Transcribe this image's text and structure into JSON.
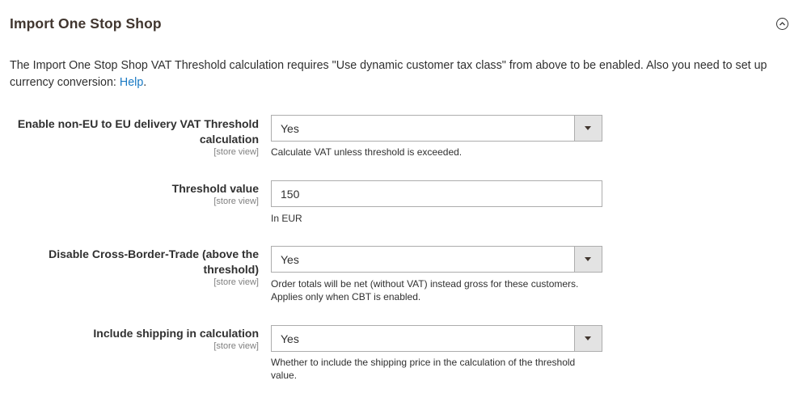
{
  "section": {
    "title": "Import One Stop Shop",
    "collapse_icon": "chevron-up-circle-icon",
    "intro_text": "The Import One Stop Shop VAT Threshold calculation requires \"Use dynamic customer tax class\" from above to be enabled. Also you need to set up currency conversion: ",
    "intro_link": "Help",
    "intro_end": "."
  },
  "fields": [
    {
      "label": "Enable non-EU to EU delivery VAT Threshold calculation",
      "scope": "[store view]",
      "type": "select",
      "value": "Yes",
      "note": "Calculate VAT unless threshold is exceeded."
    },
    {
      "label": "Threshold value",
      "scope": "[store view]",
      "type": "text",
      "value": "150",
      "note": "In EUR"
    },
    {
      "label": "Disable Cross-Border-Trade (above the threshold)",
      "scope": "[store view]",
      "type": "select",
      "value": "Yes",
      "note": "Order totals will be net (without VAT) instead gross for these customers. Applies only when CBT is enabled."
    },
    {
      "label": "Include shipping in calculation",
      "scope": "[store view]",
      "type": "select",
      "value": "Yes",
      "note": "Whether to include the shipping price in the calculation of the threshold value."
    }
  ]
}
